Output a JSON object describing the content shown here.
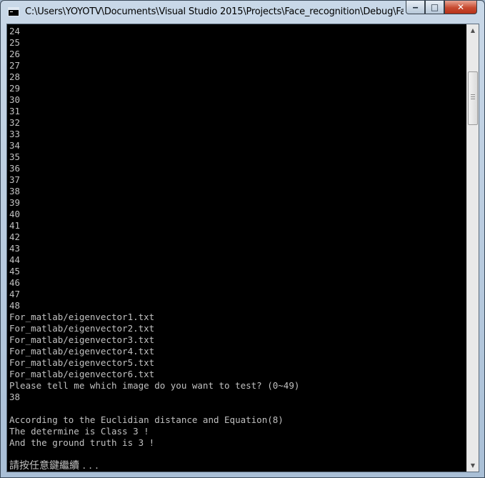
{
  "window": {
    "title": "C:\\Users\\YOYOTV\\Documents\\Visual Studio 2015\\Projects\\Face_recognition\\Debug\\Face_re...",
    "controls": {
      "minimize": "‒",
      "maximize": "□",
      "close": "✕"
    }
  },
  "console": {
    "lines": [
      "24",
      "25",
      "26",
      "27",
      "28",
      "29",
      "30",
      "31",
      "32",
      "33",
      "34",
      "35",
      "36",
      "37",
      "38",
      "39",
      "40",
      "41",
      "42",
      "43",
      "44",
      "45",
      "46",
      "47",
      "48",
      "For_matlab/eigenvector1.txt",
      "For_matlab/eigenvector2.txt",
      "For_matlab/eigenvector3.txt",
      "For_matlab/eigenvector4.txt",
      "For_matlab/eigenvector5.txt",
      "For_matlab/eigenvector6.txt",
      "Please tell me which image do you want to test? (0~49)",
      "38",
      "",
      "According to the Euclidian distance and Equation(8)",
      "The determine is Class 3 !",
      "And the ground truth is 3 !",
      ""
    ],
    "prompt": "請按任意鍵繼續 . . ."
  },
  "scrollbar": {
    "up_icon": "triangle-up",
    "down_icon": "triangle-down"
  }
}
